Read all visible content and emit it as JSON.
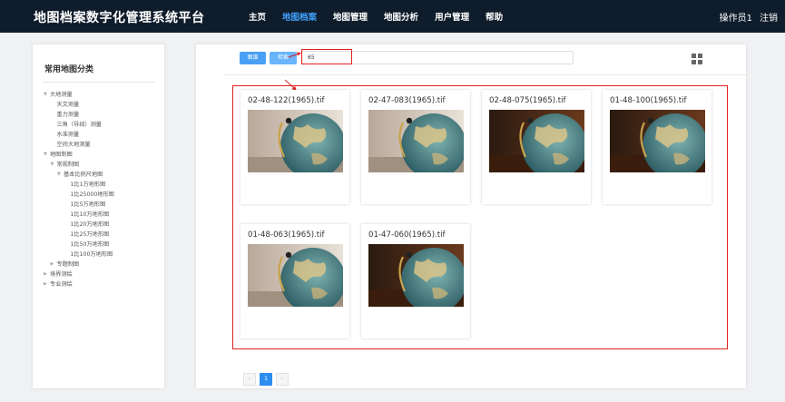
{
  "header": {
    "title": "地图档案数字化管理系统平台",
    "nav": [
      {
        "label": "主页",
        "active": false
      },
      {
        "label": "地图档案",
        "active": true
      },
      {
        "label": "地图管理",
        "active": false
      },
      {
        "label": "地图分析",
        "active": false
      },
      {
        "label": "用户管理",
        "active": false
      },
      {
        "label": "帮助",
        "active": false
      }
    ],
    "user": "操作员1",
    "logout": "注销"
  },
  "sidebar": {
    "title": "常用地图分类",
    "tree": [
      {
        "label": "大地测量",
        "level": 0,
        "arrow": "▼"
      },
      {
        "label": "天文测量",
        "level": 1
      },
      {
        "label": "重力测量",
        "level": 1
      },
      {
        "label": "三角（导线）测量",
        "level": 1
      },
      {
        "label": "水准测量",
        "level": 1
      },
      {
        "label": "空间大地测量",
        "level": 1
      },
      {
        "label": "地图制图",
        "level": 0,
        "arrow": "▼"
      },
      {
        "label": "常规制图",
        "level": 1,
        "arrow": "▼"
      },
      {
        "label": "基本比例尺地图",
        "level": 2,
        "arrow": "▼"
      },
      {
        "label": "1比1万地形图",
        "level": 3
      },
      {
        "label": "1比25000地形图",
        "level": 3
      },
      {
        "label": "1比5万地形图",
        "level": 3
      },
      {
        "label": "1比10万地形图",
        "level": 3
      },
      {
        "label": "1比20万地形图",
        "level": 3
      },
      {
        "label": "1比25万地形图",
        "level": 3
      },
      {
        "label": "1比50万地形图",
        "level": 3
      },
      {
        "label": "1比100万地形图",
        "level": 3
      },
      {
        "label": "专题制图",
        "level": 1,
        "arrow": "▶"
      },
      {
        "label": "境界测绘",
        "level": 0,
        "arrow": "▶"
      },
      {
        "label": "专业测绘",
        "level": 0,
        "arrow": "▶"
      }
    ]
  },
  "toolbar": {
    "album_label": "图谱",
    "search_label": "检索",
    "search_value": "65"
  },
  "results": [
    {
      "name": "02-48-122(1965).tif",
      "thumb": "globe-light"
    },
    {
      "name": "02-47-083(1965).tif",
      "thumb": "globe-light"
    },
    {
      "name": "02-48-075(1965).tif",
      "thumb": "globe-dark"
    },
    {
      "name": "01-48-100(1965).tif",
      "thumb": "globe-dark"
    },
    {
      "name": "01-48-063(1965).tif",
      "thumb": "globe-light"
    },
    {
      "name": "01-47-060(1965).tif",
      "thumb": "globe-dark"
    }
  ],
  "pagination": {
    "prev": "‹",
    "current": "1",
    "next": "›"
  },
  "colors": {
    "header_bg": "#0f1c2b",
    "active_nav": "#41a2ff",
    "primary_button": "#4aa0f5",
    "highlight": "#e02020"
  },
  "icons": [
    "grid-view-icon",
    "red-arrow-icon",
    "globe-thumbnail"
  ]
}
